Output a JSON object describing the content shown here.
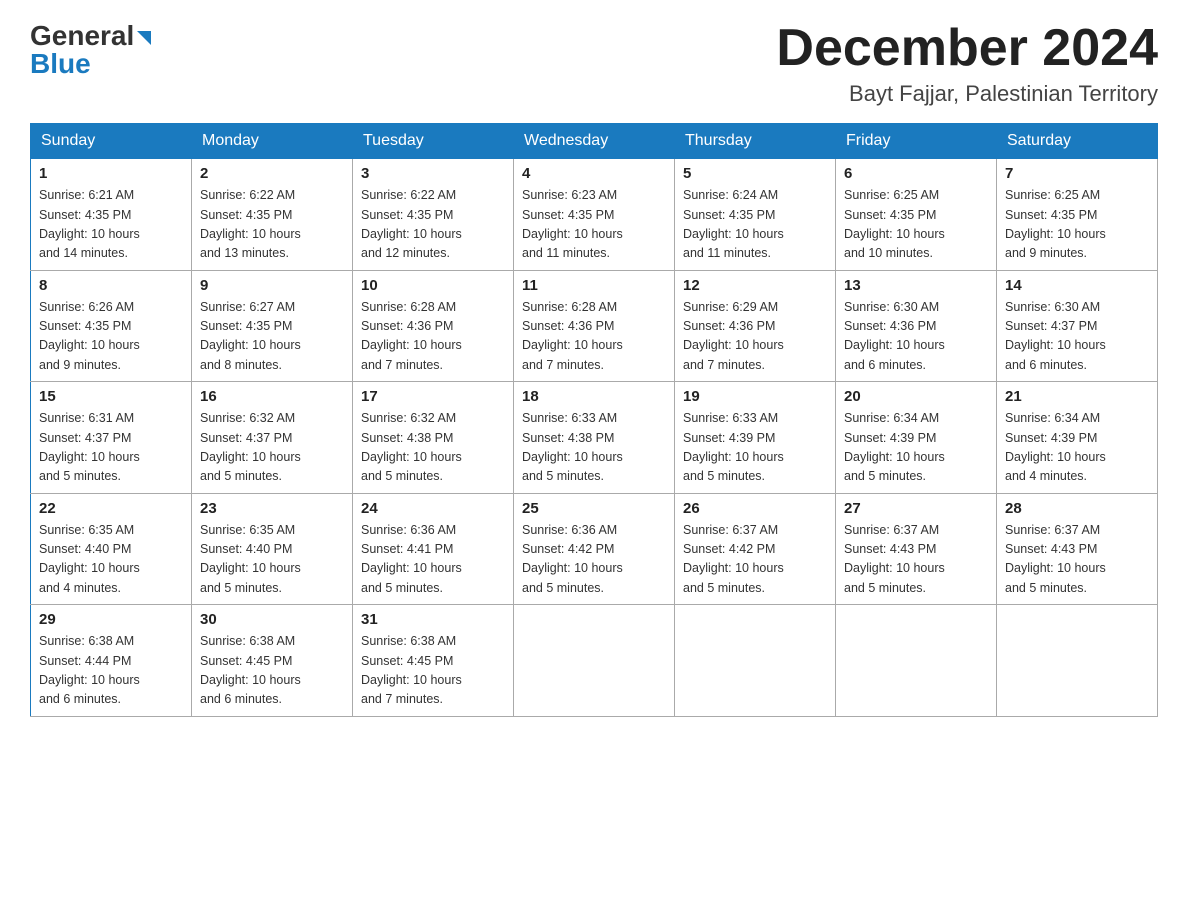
{
  "header": {
    "logo_general": "General",
    "logo_blue": "Blue",
    "month_title": "December 2024",
    "location": "Bayt Fajjar, Palestinian Territory"
  },
  "days_of_week": [
    "Sunday",
    "Monday",
    "Tuesday",
    "Wednesday",
    "Thursday",
    "Friday",
    "Saturday"
  ],
  "weeks": [
    [
      {
        "day": "1",
        "sunrise": "6:21 AM",
        "sunset": "4:35 PM",
        "daylight": "10 hours and 14 minutes."
      },
      {
        "day": "2",
        "sunrise": "6:22 AM",
        "sunset": "4:35 PM",
        "daylight": "10 hours and 13 minutes."
      },
      {
        "day": "3",
        "sunrise": "6:22 AM",
        "sunset": "4:35 PM",
        "daylight": "10 hours and 12 minutes."
      },
      {
        "day": "4",
        "sunrise": "6:23 AM",
        "sunset": "4:35 PM",
        "daylight": "10 hours and 11 minutes."
      },
      {
        "day": "5",
        "sunrise": "6:24 AM",
        "sunset": "4:35 PM",
        "daylight": "10 hours and 11 minutes."
      },
      {
        "day": "6",
        "sunrise": "6:25 AM",
        "sunset": "4:35 PM",
        "daylight": "10 hours and 10 minutes."
      },
      {
        "day": "7",
        "sunrise": "6:25 AM",
        "sunset": "4:35 PM",
        "daylight": "10 hours and 9 minutes."
      }
    ],
    [
      {
        "day": "8",
        "sunrise": "6:26 AM",
        "sunset": "4:35 PM",
        "daylight": "10 hours and 9 minutes."
      },
      {
        "day": "9",
        "sunrise": "6:27 AM",
        "sunset": "4:35 PM",
        "daylight": "10 hours and 8 minutes."
      },
      {
        "day": "10",
        "sunrise": "6:28 AM",
        "sunset": "4:36 PM",
        "daylight": "10 hours and 7 minutes."
      },
      {
        "day": "11",
        "sunrise": "6:28 AM",
        "sunset": "4:36 PM",
        "daylight": "10 hours and 7 minutes."
      },
      {
        "day": "12",
        "sunrise": "6:29 AM",
        "sunset": "4:36 PM",
        "daylight": "10 hours and 7 minutes."
      },
      {
        "day": "13",
        "sunrise": "6:30 AM",
        "sunset": "4:36 PM",
        "daylight": "10 hours and 6 minutes."
      },
      {
        "day": "14",
        "sunrise": "6:30 AM",
        "sunset": "4:37 PM",
        "daylight": "10 hours and 6 minutes."
      }
    ],
    [
      {
        "day": "15",
        "sunrise": "6:31 AM",
        "sunset": "4:37 PM",
        "daylight": "10 hours and 5 minutes."
      },
      {
        "day": "16",
        "sunrise": "6:32 AM",
        "sunset": "4:37 PM",
        "daylight": "10 hours and 5 minutes."
      },
      {
        "day": "17",
        "sunrise": "6:32 AM",
        "sunset": "4:38 PM",
        "daylight": "10 hours and 5 minutes."
      },
      {
        "day": "18",
        "sunrise": "6:33 AM",
        "sunset": "4:38 PM",
        "daylight": "10 hours and 5 minutes."
      },
      {
        "day": "19",
        "sunrise": "6:33 AM",
        "sunset": "4:39 PM",
        "daylight": "10 hours and 5 minutes."
      },
      {
        "day": "20",
        "sunrise": "6:34 AM",
        "sunset": "4:39 PM",
        "daylight": "10 hours and 5 minutes."
      },
      {
        "day": "21",
        "sunrise": "6:34 AM",
        "sunset": "4:39 PM",
        "daylight": "10 hours and 4 minutes."
      }
    ],
    [
      {
        "day": "22",
        "sunrise": "6:35 AM",
        "sunset": "4:40 PM",
        "daylight": "10 hours and 4 minutes."
      },
      {
        "day": "23",
        "sunrise": "6:35 AM",
        "sunset": "4:40 PM",
        "daylight": "10 hours and 5 minutes."
      },
      {
        "day": "24",
        "sunrise": "6:36 AM",
        "sunset": "4:41 PM",
        "daylight": "10 hours and 5 minutes."
      },
      {
        "day": "25",
        "sunrise": "6:36 AM",
        "sunset": "4:42 PM",
        "daylight": "10 hours and 5 minutes."
      },
      {
        "day": "26",
        "sunrise": "6:37 AM",
        "sunset": "4:42 PM",
        "daylight": "10 hours and 5 minutes."
      },
      {
        "day": "27",
        "sunrise": "6:37 AM",
        "sunset": "4:43 PM",
        "daylight": "10 hours and 5 minutes."
      },
      {
        "day": "28",
        "sunrise": "6:37 AM",
        "sunset": "4:43 PM",
        "daylight": "10 hours and 5 minutes."
      }
    ],
    [
      {
        "day": "29",
        "sunrise": "6:38 AM",
        "sunset": "4:44 PM",
        "daylight": "10 hours and 6 minutes."
      },
      {
        "day": "30",
        "sunrise": "6:38 AM",
        "sunset": "4:45 PM",
        "daylight": "10 hours and 6 minutes."
      },
      {
        "day": "31",
        "sunrise": "6:38 AM",
        "sunset": "4:45 PM",
        "daylight": "10 hours and 7 minutes."
      },
      null,
      null,
      null,
      null
    ]
  ],
  "labels": {
    "sunrise": "Sunrise:",
    "sunset": "Sunset:",
    "daylight": "Daylight:"
  }
}
